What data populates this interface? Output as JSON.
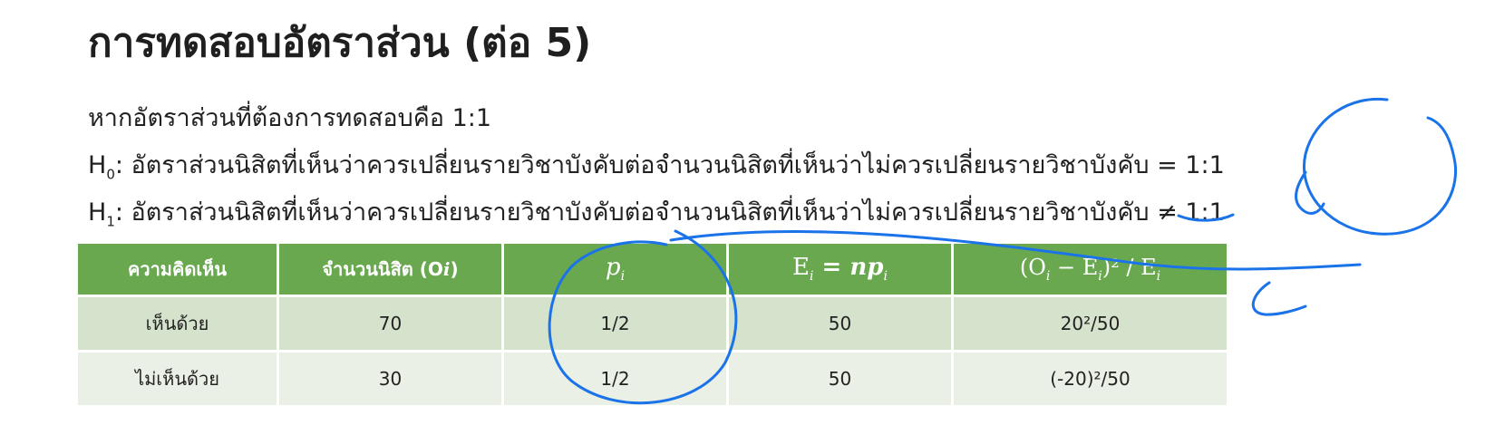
{
  "title": "การทดสอบอัตราส่วน (ต่อ 5)",
  "intro": "หากอัตราส่วนที่ต้องการทดสอบคือ 1:1",
  "h0": {
    "symbol": "H",
    "sub": "0",
    "text": ": อัตราส่วนนิสิตที่เห็นว่าควรเปลี่ยนรายวิชาบังคับต่อจำนวนนิสิตที่เห็นว่าไม่ควรเปลี่ยนรายวิชาบังคับ = 1:1"
  },
  "h1": {
    "symbol": "H",
    "sub": "1",
    "text": ": อัตราส่วนนิสิตที่เห็นว่าควรเปลี่ยนรายวิชาบังคับต่อจำนวนนิสิตที่เห็นว่าไม่ควรเปลี่ยนรายวิชาบังคับ ≠ 1:1"
  },
  "table": {
    "headers": {
      "opinion": "ความคิดเห็น",
      "count_text": "จำนวนนิสิต (O",
      "count_sub": "i",
      "count_close": ")",
      "p": "p",
      "p_sub": "i",
      "e_left": "E",
      "e_sub": "i",
      "e_right": " = np",
      "e_right_sub": "i",
      "chi_left": "(O",
      "chi_sub1": "i",
      "chi_mid": " − E",
      "chi_sub2": "i",
      "chi_right": ")² / E",
      "chi_sub3": "i"
    },
    "rows": [
      {
        "opinion": "เห็นด้วย",
        "count": "70",
        "p": "1/2",
        "e": "50",
        "chi": "20²/50"
      },
      {
        "opinion": "ไม่เห็นด้วย",
        "count": "30",
        "p": "1/2",
        "e": "50",
        "chi": "(-20)²/50"
      }
    ]
  },
  "annotation_color": "#1a73e8",
  "header_color": "#6aa84f"
}
